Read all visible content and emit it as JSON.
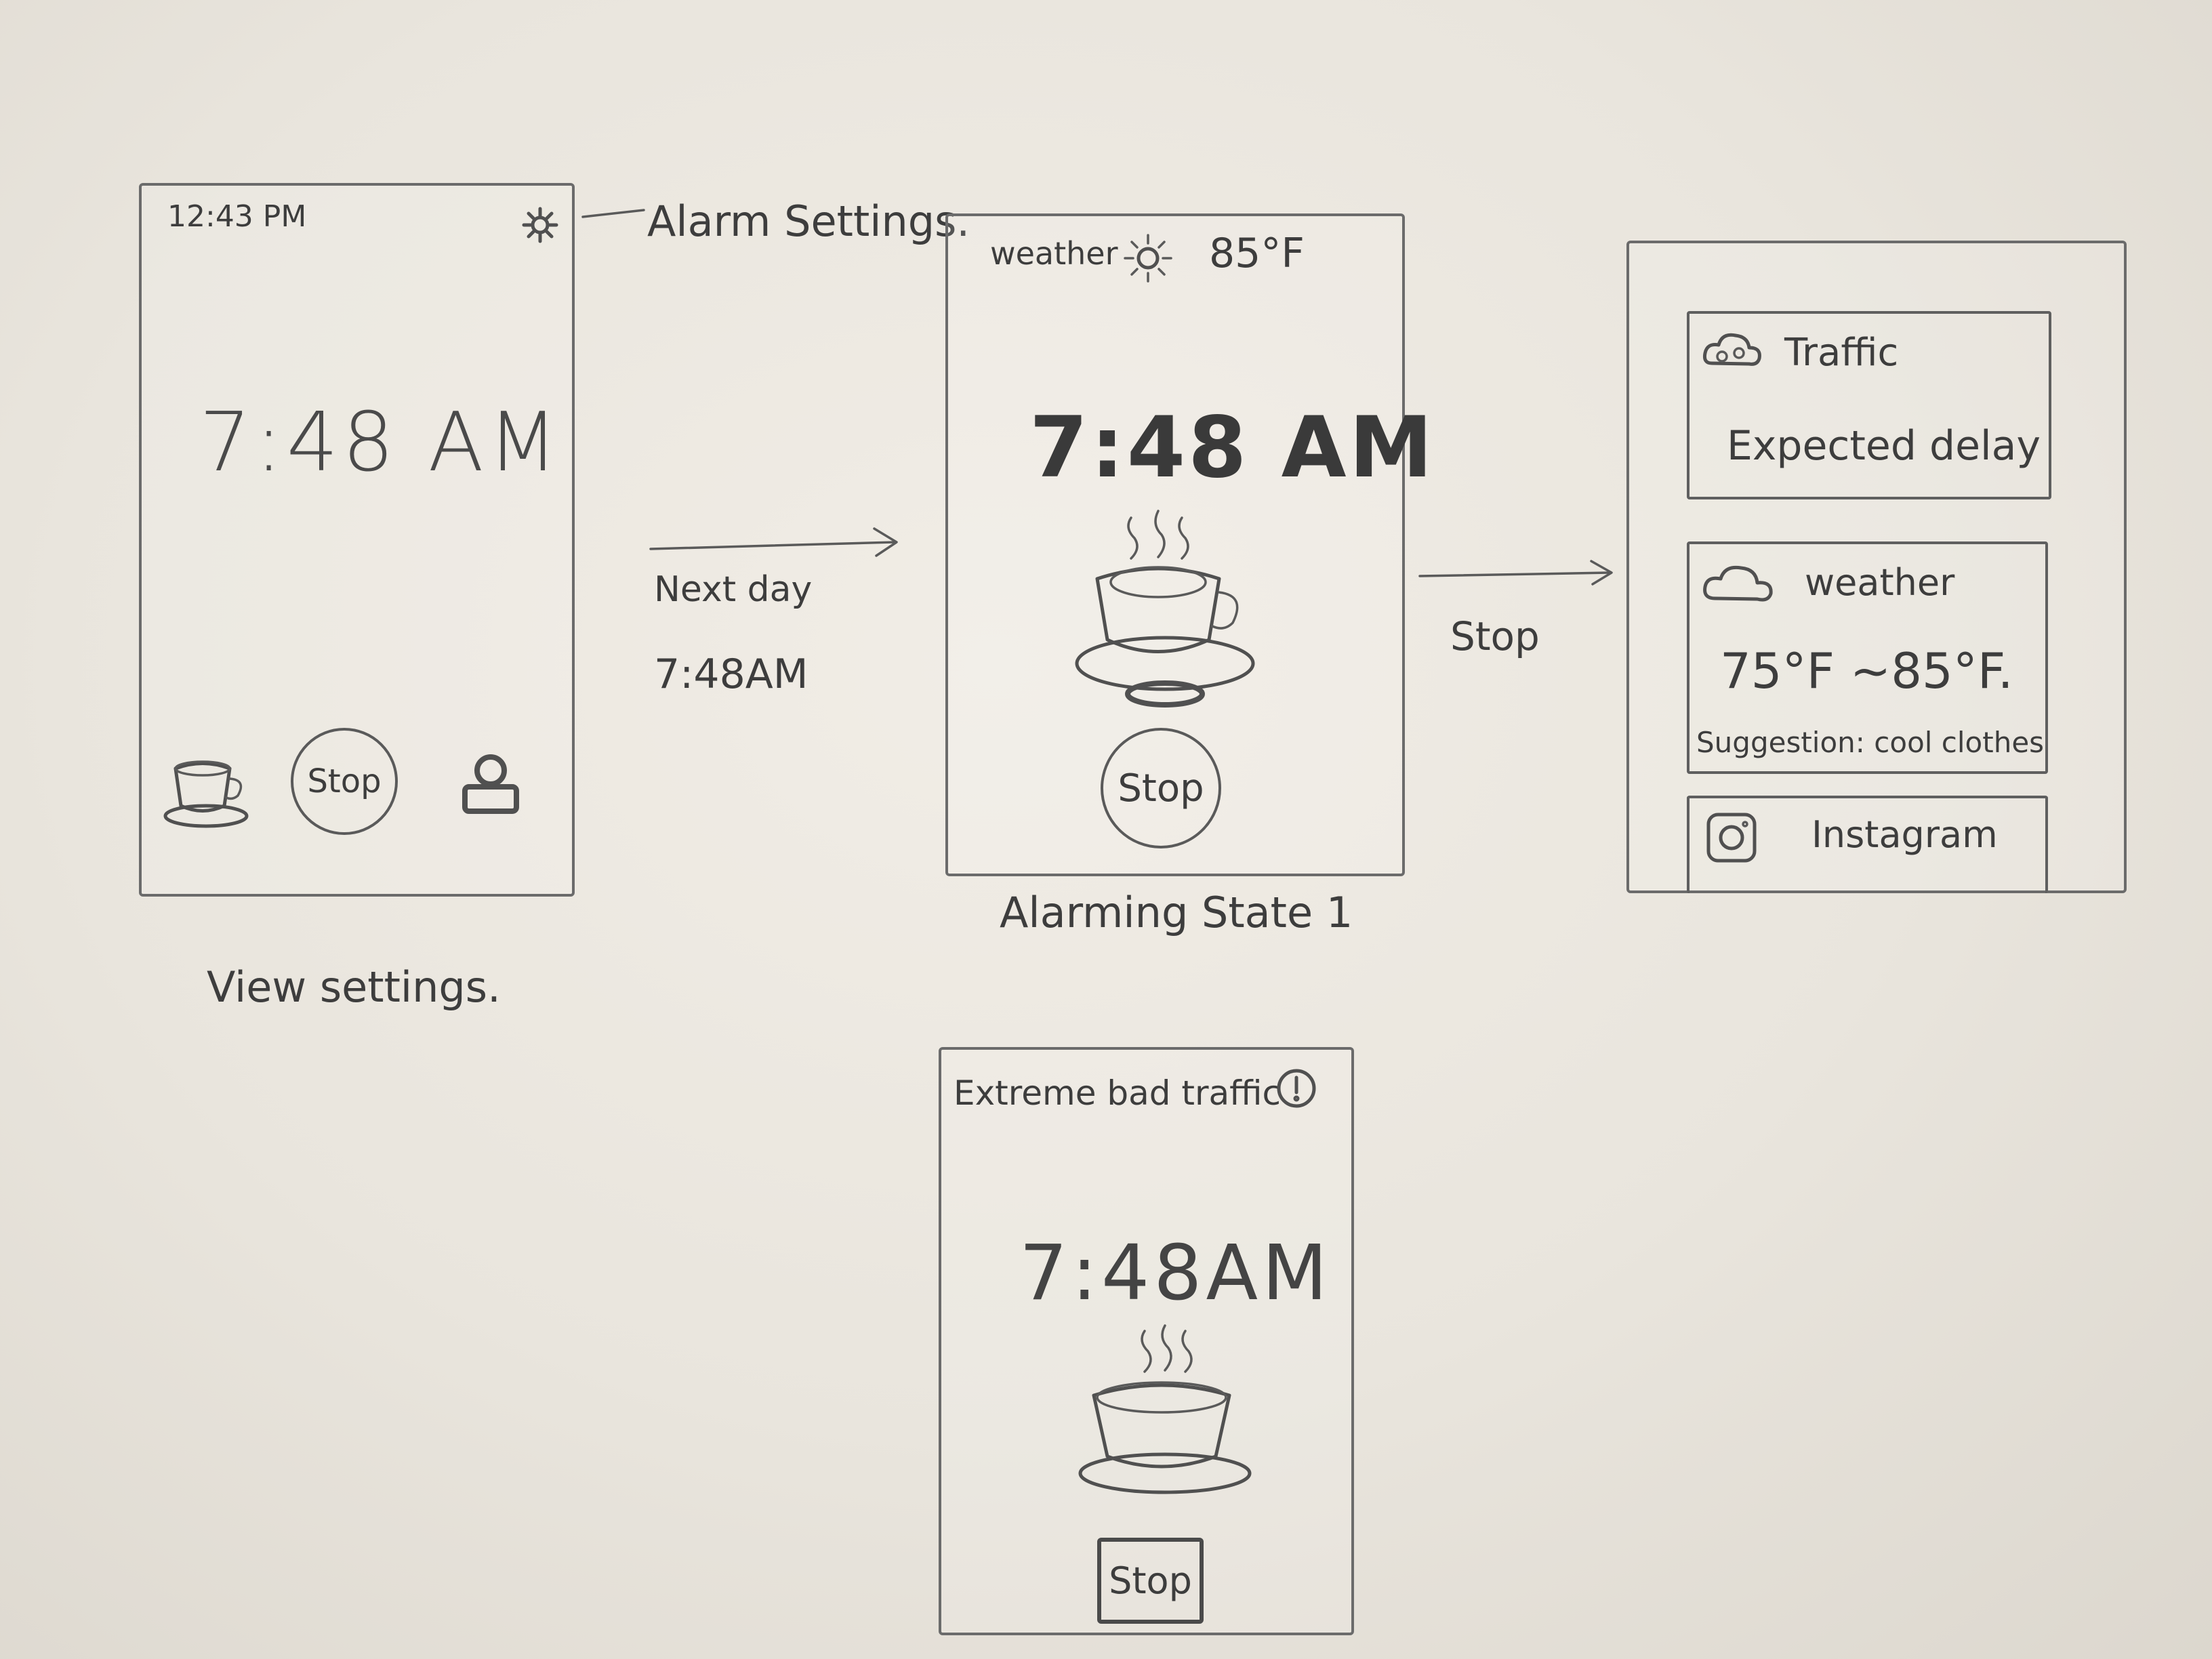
{
  "screen1": {
    "status_time": "12:43 PM",
    "alarm_time": "7:48 AM",
    "stop_label": "Stop",
    "icons": {
      "settings": "gear-icon",
      "left": "coffee-cup-icon",
      "right": "profile-icon"
    }
  },
  "annotations": {
    "alarm_settings": "Alarm Settings.",
    "next_day": "Next day",
    "next_day_time": "7:48AM",
    "view_settings": "View settings.",
    "stop_transition": "Stop",
    "alarming_state": "Alarming State 1"
  },
  "screen2": {
    "weather_label": "weather",
    "temperature": "85°F",
    "alarm_time": "7:48 AM",
    "stop_label": "Stop",
    "icons": {
      "weather": "sun-icon",
      "main": "steaming-coffee-icon"
    }
  },
  "screen3": {
    "traffic": {
      "title": "Traffic",
      "body": "Expected delay",
      "icon": "traffic-cloud-icon"
    },
    "weather": {
      "title": "weather",
      "range": "75°F ~85°F.",
      "suggestion": "Suggestion: cool clothes",
      "icon": "cloud-icon"
    },
    "instagram": {
      "title": "Instagram",
      "icon": "instagram-icon"
    }
  },
  "screen4": {
    "alert": "Extreme bad traffic",
    "alarm_time": "7:48AM",
    "stop_label": "Stop",
    "icons": {
      "alert": "exclamation-icon",
      "main": "steaming-coffee-icon"
    }
  }
}
